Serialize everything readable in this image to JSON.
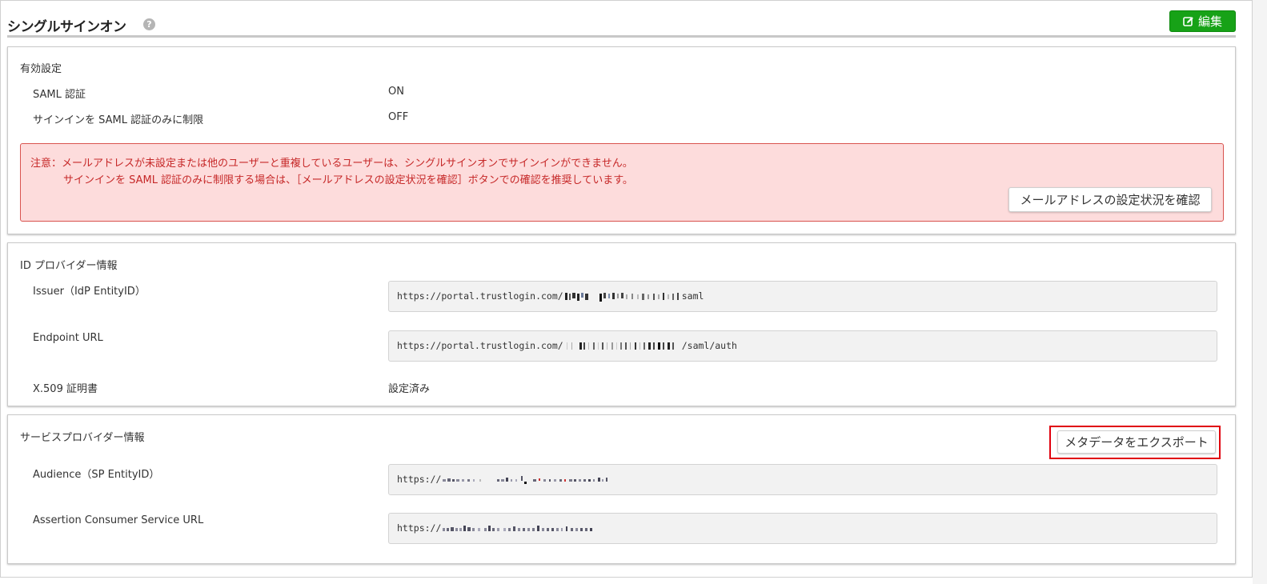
{
  "header": {
    "title": "シングルサインオン",
    "help_icon": "?",
    "edit_label": "編集",
    "edit_color": "#17a217"
  },
  "activation": {
    "title": "有効設定",
    "rows": [
      {
        "label": "SAML 認証",
        "value": "ON"
      },
      {
        "label": "サインインを SAML 認証のみに制限",
        "value": "OFF"
      }
    ],
    "alert": {
      "line1": "注意：メールアドレスが未設定または他のユーザーと重複しているユーザーは、シングルサインオンでサインインができません。",
      "line2": "サインインを SAML 認証のみに制限する場合は、［メールアドレスの設定状況を確認］ボタンでの確認を推奨しています。",
      "button": "メールアドレスの設定状況を確認",
      "color": "#c62828"
    }
  },
  "idp": {
    "title": "ID プロバイダー情報",
    "issuer_label": "Issuer（IdP EntityID）",
    "issuer_prefix": "https://portal.trustlogin.com/",
    "issuer_suffix": "saml",
    "endpoint_label": "Endpoint URL",
    "endpoint_prefix": "https://portal.trustlogin.com/",
    "endpoint_suffix": "/saml/auth",
    "cert_label": "X.509 証明書",
    "cert_value": "設定済み"
  },
  "sp": {
    "title": "サービスプロバイダー情報",
    "export_button": "メタデータをエクスポート",
    "highlight_color": "#e0000d",
    "audience_label": "Audience（SP EntityID）",
    "audience_prefix": "https://",
    "acs_label": "Assertion Consumer Service URL",
    "acs_prefix": "https://"
  }
}
